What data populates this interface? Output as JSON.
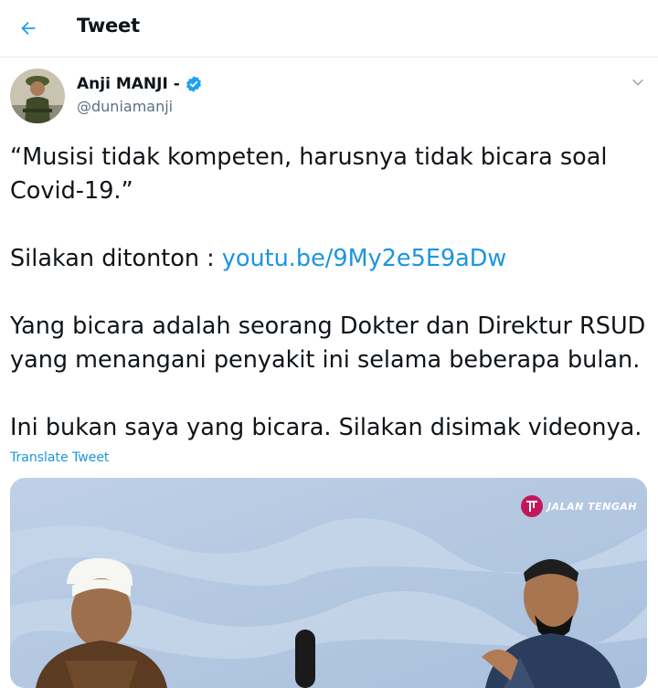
{
  "header": {
    "title": "Tweet",
    "back_icon": "back-arrow-icon"
  },
  "author": {
    "name": "Anji MANJI -",
    "handle": "@duniamanji",
    "verified_icon": "verified-badge-icon"
  },
  "tweet": {
    "line1": "“Musisi tidak kompeten, harusnya tidak bicara soal Covid-19.”",
    "prompt": "Silakan ditonton : ",
    "link_text": "youtu.be/9My2e5E9aDw",
    "line3": "Yang bicara adalah seorang Dokter dan Direktur RSUD yang menangani penyakit ini selama beberapa bulan.",
    "line4": "Ini bukan saya yang bicara. Silakan disimak videonya."
  },
  "translate_label": "Translate Tweet",
  "media": {
    "watermark": "JALAN TENGAH"
  },
  "colors": {
    "accent": "#1da1f2",
    "link": "#1b95e0",
    "secondary": "#5b7083"
  }
}
